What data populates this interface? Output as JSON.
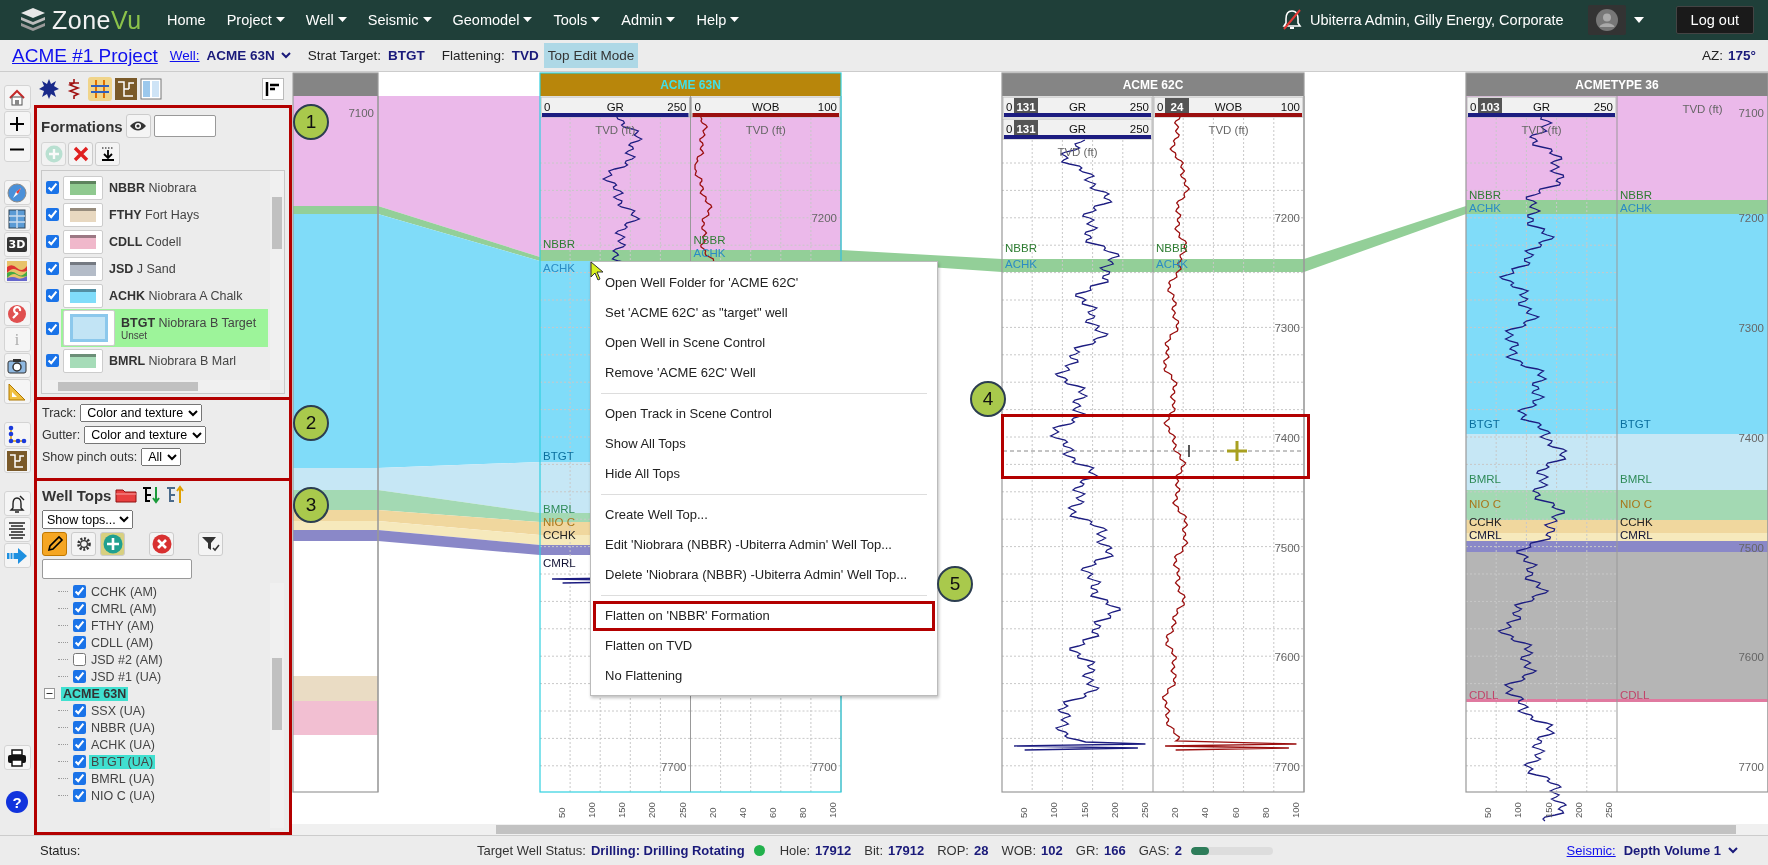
{
  "nav": {
    "logo": [
      "Zone",
      "Vu"
    ],
    "menu": [
      {
        "label": "Home",
        "dropdown": false
      },
      {
        "label": "Project",
        "dropdown": true
      },
      {
        "label": "Well",
        "dropdown": true
      },
      {
        "label": "Seismic",
        "dropdown": true
      },
      {
        "label": "Geomodel",
        "dropdown": true
      },
      {
        "label": "Tools",
        "dropdown": true
      },
      {
        "label": "Admin",
        "dropdown": true
      },
      {
        "label": "Help",
        "dropdown": true
      }
    ],
    "user": "Ubiterra Admin, Gilly Energy, Corporate",
    "logout": "Log out"
  },
  "project_bar": {
    "project": "ACME #1 Project",
    "fields": [
      {
        "label": "Well:",
        "value": "ACME 63N",
        "kind": "link"
      },
      {
        "label": "Strat Target:",
        "value": "BTGT",
        "kind": "text"
      },
      {
        "label": "Flattening:",
        "value": "TVD",
        "kind": "text"
      }
    ],
    "mode": "Top Edit Mode",
    "az_label": "AZ:",
    "az": "175°"
  },
  "toolbar_glyphs": {
    "three_d": "3D",
    "info": "i",
    "help": "?"
  },
  "formations": {
    "title": "Formations",
    "items": [
      {
        "code": "NBBR",
        "name": "Niobrara",
        "checked": true,
        "selected": false,
        "color": "#8fc98f"
      },
      {
        "code": "FTHY",
        "name": "Fort Hays",
        "checked": true,
        "selected": false,
        "color": "#e8d8c0"
      },
      {
        "code": "CDLL",
        "name": "Codell",
        "checked": true,
        "selected": false,
        "color": "#f0b8cb"
      },
      {
        "code": "JSD",
        "name": "J Sand",
        "checked": true,
        "selected": false,
        "color": "#b4bcc8"
      },
      {
        "code": "ACHK",
        "name": "Niobrara A Chalk",
        "checked": true,
        "selected": false,
        "color": "#80dcfa"
      },
      {
        "code": "BTGT",
        "name": "Niobrara B Target",
        "note": "Unset",
        "checked": true,
        "selected": true,
        "color": "#c2e4f5"
      },
      {
        "code": "BMRL",
        "name": "Niobrara B Marl",
        "checked": true,
        "selected": false,
        "color": "#a6dcb8"
      }
    ]
  },
  "display_options": [
    {
      "label": "Track:",
      "value": "Color and texture"
    },
    {
      "label": "Gutter:",
      "value": "Color and texture"
    },
    {
      "label": "Show pinch outs:",
      "value": "All"
    }
  ],
  "well_tops": {
    "title": "Well Tops",
    "filter": "Show tops...",
    "edit_mode": true,
    "tree": [
      {
        "children": [
          {
            "label": "CCHK (AM)",
            "checked": true,
            "highlighted": false
          },
          {
            "label": "CMRL (AM)",
            "checked": true,
            "highlighted": false
          },
          {
            "label": "FTHY (AM)",
            "checked": true,
            "highlighted": false
          },
          {
            "label": "CDLL (AM)",
            "checked": true,
            "highlighted": false
          },
          {
            "label": "JSD #2 (AM)",
            "checked": false,
            "highlighted": false
          },
          {
            "label": "JSD #1 (UA)",
            "checked": true,
            "highlighted": false
          }
        ]
      },
      {
        "label": "ACME 63N",
        "expanded": true,
        "highlighted": true,
        "children": [
          {
            "label": "SSX (UA)",
            "checked": true,
            "highlighted": false
          },
          {
            "label": "NBBR (UA)",
            "checked": true,
            "highlighted": false
          },
          {
            "label": "ACHK (UA)",
            "checked": true,
            "highlighted": false
          },
          {
            "label": "BTGT (UA)",
            "checked": true,
            "highlighted": true
          },
          {
            "label": "BMRL (UA)",
            "checked": true,
            "highlighted": false
          },
          {
            "label": "NIO C (UA)",
            "checked": true,
            "highlighted": false
          }
        ]
      }
    ]
  },
  "wells": [
    {
      "kind": "offset",
      "tracks": [
        {
          "depth_labels": [
            "7100"
          ]
        }
      ]
    },
    {
      "kind": "target",
      "name": "ACME 63N",
      "tracks": [
        {
          "header_rows": [
            {
              "min": "0",
              "curve": "GR",
              "max": "250",
              "color": "#1c1c80"
            }
          ],
          "depth_header": "TVD (ft)",
          "depth_labels": [
            "7700"
          ],
          "tops": [
            {
              "label": "NBBR",
              "color": "#2e7d32"
            },
            {
              "label": "ACHK",
              "color": "#2b8cc4"
            },
            {
              "label": "BTGT",
              "color": "#0a6f9e"
            },
            {
              "label": "BMRL",
              "color": "#2e8b57"
            },
            {
              "label": "NIO C",
              "color": "#a8761a"
            },
            {
              "label": "CCHK",
              "color": "#222222"
            },
            {
              "label": "CMRL",
              "color": "#111133"
            }
          ],
          "ticks": [
            "50",
            "100",
            "150",
            "200",
            "250"
          ]
        },
        {
          "header_rows": [
            {
              "min": "0",
              "curve": "WOB",
              "max": "100",
              "color": "#9b0f0f"
            }
          ],
          "depth_header": "TVD (ft)",
          "depth_labels": [
            "7200",
            "7700"
          ],
          "tops": [
            {
              "label": "NBBR",
              "color": "#2e7d32"
            },
            {
              "label": "ACHK",
              "color": "#2b8cc4"
            }
          ],
          "ticks": [
            "20",
            "40",
            "60",
            "80",
            "100"
          ]
        }
      ]
    },
    {
      "kind": "offset",
      "name": "ACME 62C",
      "tracks": [
        {
          "header_rows": [
            {
              "min": "0",
              "reading": "131",
              "curve": "GR",
              "max": "250",
              "color": "#1c1c80"
            },
            {
              "min": "0",
              "reading": "131",
              "curve": "GR",
              "max": "250",
              "color": "#1c1c80"
            }
          ],
          "depth_header": "TVD (ft)",
          "tops": [
            {
              "label": "NBBR",
              "color": "#2e7d32"
            },
            {
              "label": "ACHK",
              "color": "#2b8cc4"
            }
          ],
          "ticks": [
            "50",
            "100",
            "150",
            "200",
            "250"
          ]
        },
        {
          "header_rows": [
            {
              "min": "0",
              "reading": "24",
              "curve": "WOB",
              "max": "100",
              "color": "#9b0f0f"
            }
          ],
          "depth_header": "TVD (ft)",
          "depth_labels": [
            "7200",
            "7300",
            "7400",
            "7500",
            "7600",
            "7700"
          ],
          "tops": [
            {
              "label": "NBBR",
              "color": "#2e7d32"
            },
            {
              "label": "ACHK",
              "color": "#2b8cc4"
            }
          ],
          "ticks": [
            "20",
            "40",
            "60",
            "80",
            "100"
          ]
        }
      ]
    },
    {
      "kind": "offset",
      "name": "ACMETYPE 36",
      "tracks": [
        {
          "header_rows": [
            {
              "min": "0",
              "reading": "103",
              "curve": "GR",
              "max": "250",
              "color": "#1c1c80"
            }
          ],
          "depth_header": "TVD (ft)",
          "tops": [
            {
              "label": "NBBR",
              "color": "#2e7d32"
            },
            {
              "label": "ACHK",
              "color": "#2b8cc4"
            },
            {
              "label": "BTGT",
              "color": "#0a6f9e"
            },
            {
              "label": "BMRL",
              "color": "#2e8b57"
            },
            {
              "label": "NIO C",
              "color": "#a8761a"
            },
            {
              "label": "CCHK",
              "color": "#222222"
            },
            {
              "label": "CMRL",
              "color": "#111133"
            },
            {
              "label": "CDLL",
              "color": "#c0446a"
            }
          ],
          "ticks": [
            "50",
            "100",
            "150",
            "200",
            "250"
          ]
        },
        {
          "depth_header": "TVD (ft)",
          "depth_labels": [
            "7100",
            "7200",
            "7300",
            "7400",
            "7500",
            "7600",
            "7700"
          ],
          "tops": [
            {
              "label": "NBBR",
              "color": "#2e7d32"
            },
            {
              "label": "ACHK",
              "color": "#2b8cc4"
            },
            {
              "label": "BTGT",
              "color": "#0a6f9e"
            },
            {
              "label": "BMRL",
              "color": "#2e8b57"
            },
            {
              "label": "NIO C",
              "color": "#a8761a"
            },
            {
              "label": "CCHK",
              "color": "#222222"
            },
            {
              "label": "CMRL",
              "color": "#111133"
            },
            {
              "label": "CDLL",
              "color": "#c0446a"
            }
          ]
        }
      ]
    }
  ],
  "context_menu": {
    "groups": [
      [
        {
          "label": "Open Well Folder for 'ACME 62C'",
          "highlighted": false
        },
        {
          "label": "Set 'ACME 62C' as \"target\" well",
          "highlighted": false
        },
        {
          "label": "Open Well in Scene Control",
          "highlighted": false
        },
        {
          "label": "Remove 'ACME 62C' Well",
          "highlighted": false
        }
      ],
      [
        {
          "label": "Open Track in Scene Control",
          "highlighted": false
        },
        {
          "label": "Show All Tops",
          "highlighted": false
        },
        {
          "label": "Hide All Tops",
          "highlighted": false
        }
      ],
      [
        {
          "label": "Create Well Top...",
          "highlighted": false
        },
        {
          "label": "Edit 'Niobrara (NBBR) -Ubiterra Admin' Well Top...",
          "highlighted": false
        },
        {
          "label": "Delete 'Niobrara (NBBR) -Ubiterra Admin' Well Top...",
          "highlighted": false
        }
      ],
      [
        {
          "label": "Flatten on 'NBBR' Formation",
          "highlighted": true
        },
        {
          "label": "Flatten on TVD",
          "highlighted": false
        },
        {
          "label": "No Flattening",
          "highlighted": false
        }
      ]
    ]
  },
  "callouts": [
    "1",
    "2",
    "3",
    "4",
    "5"
  ],
  "status_bar": {
    "label": "Status:",
    "target_label": "Target Well Status:",
    "target_value": "Drilling: Drilling Rotating",
    "rig_active": true,
    "metrics": [
      {
        "label": "Hole:",
        "value": "17912"
      },
      {
        "label": "Bit:",
        "value": "17912"
      },
      {
        "label": "ROP:",
        "value": "28"
      },
      {
        "label": "WOB:",
        "value": "102"
      },
      {
        "label": "GR:",
        "value": "166"
      },
      {
        "label": "GAS:",
        "value": "2"
      }
    ],
    "gas_meter": {
      "level": 0.22
    },
    "seismic_label": "Seismic:",
    "seismic": "Depth Volume 1"
  }
}
